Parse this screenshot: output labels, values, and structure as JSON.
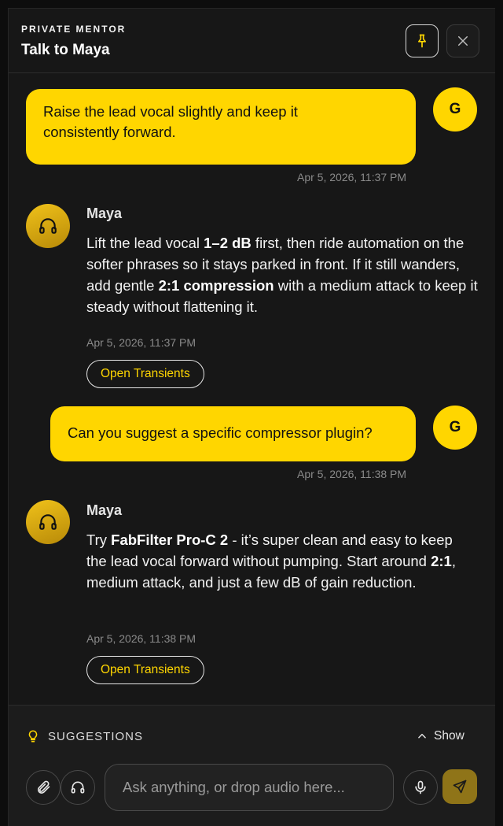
{
  "header": {
    "eyebrow": "PRIVATE MENTOR",
    "title": "Talk to Maya",
    "pin_icon": "pin-icon",
    "close_icon": "close-icon"
  },
  "messages": [
    {
      "role": "user",
      "avatar": "G",
      "lines": [
        "Raise the lead vocal slightly and keep it",
        "consistently forward."
      ],
      "timestamp": "Apr 5, 2026, 11:37 PM"
    },
    {
      "role": "mentor",
      "name": "Maya",
      "avatar_icon": "headphones-icon",
      "text": {
        "p1": "Lift the lead vocal ",
        "b1": "1–2 dB",
        "p2": " first, then ride automation on the softer phrases so it stays parked in front. If it still wanders, add gentle ",
        "b2": "2:1 compression",
        "p3": " with a medium attack to keep it steady without flattening it."
      },
      "timestamp": "Apr 5, 2026, 11:37 PM",
      "action_label": "Open Transients"
    },
    {
      "role": "user",
      "avatar": "G",
      "lines": [
        "Can you suggest a specific compressor plugin?"
      ],
      "timestamp": "Apr 5, 2026, 11:38 PM"
    },
    {
      "role": "mentor",
      "name": "Maya",
      "avatar_icon": "headphones-icon",
      "text": {
        "p1": "Try ",
        "b1": "FabFilter Pro-C 2",
        "p2": " - it’s super clean and easy to keep the lead vocal forward without pumping. Start around ",
        "b2": "2:1",
        "p3": ", medium attack, and just a few dB of gain reduction."
      },
      "timestamp": "Apr 5, 2026, 11:38 PM",
      "action_label": "Open Transients"
    }
  ],
  "suggestions": {
    "label": "SUGGESTIONS",
    "icon": "lightbulb-icon",
    "toggle_label": "Show",
    "toggle_icon": "chevron-up-icon"
  },
  "composer": {
    "placeholder": "Ask anything, or drop audio here...",
    "attach_icon": "paperclip-icon",
    "audio_icon": "headphones-icon",
    "mic_icon": "microphone-icon",
    "send_icon": "send-icon"
  },
  "colors": {
    "accent": "#ffd600",
    "background": "#171717",
    "send_button": "#8f7418"
  }
}
